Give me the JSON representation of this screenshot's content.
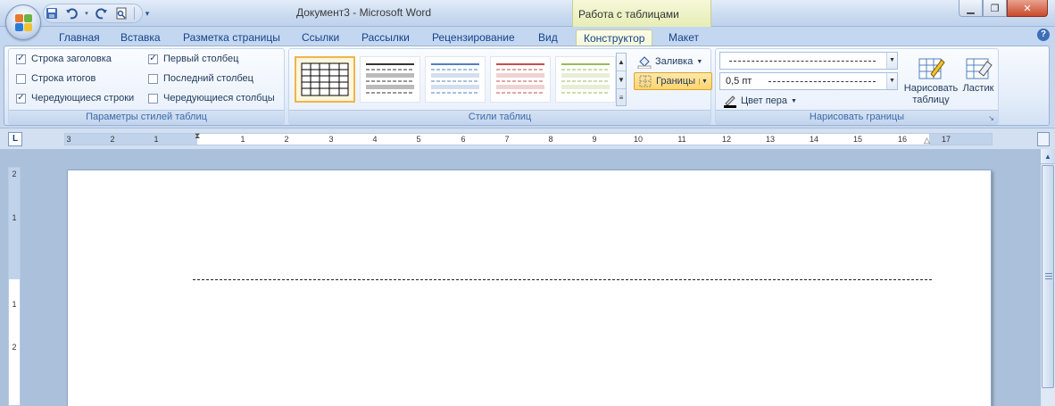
{
  "window": {
    "title": "Документ3 - Microsoft Word",
    "contextual_header": "Работа с таблицами",
    "minimize": "▁",
    "restore": "❐",
    "close": "✕"
  },
  "qat": {
    "icons": [
      "save-icon",
      "undo-icon",
      "redo-icon",
      "print-preview-icon",
      "customize-qat-icon"
    ]
  },
  "tabs": [
    {
      "label": "Главная"
    },
    {
      "label": "Вставка"
    },
    {
      "label": "Разметка страницы"
    },
    {
      "label": "Ссылки"
    },
    {
      "label": "Рассылки"
    },
    {
      "label": "Рецензирование"
    },
    {
      "label": "Вид"
    },
    {
      "label": "Конструктор",
      "active": true
    },
    {
      "label": "Макет"
    }
  ],
  "help": "?",
  "table_style_options": {
    "group_label": "Параметры стилей таблиц",
    "options": [
      {
        "label": "Строка заголовка",
        "checked": true
      },
      {
        "label": "Строка итогов",
        "checked": false
      },
      {
        "label": "Чередующиеся строки",
        "checked": true
      },
      {
        "label": "Первый столбец",
        "checked": true
      },
      {
        "label": "Последний столбец",
        "checked": false
      },
      {
        "label": "Чередующиеся столбцы",
        "checked": false
      }
    ]
  },
  "table_styles": {
    "group_label": "Стили таблиц",
    "shading_label": "Заливка",
    "borders_label": "Границы",
    "thumb_colors": [
      "#333333",
      "#333333",
      "#4f81bd",
      "#c0504d",
      "#9bbb59"
    ]
  },
  "draw_borders": {
    "group_label": "Нарисовать границы",
    "pen_weight": "0,5 пт",
    "pen_color_label": "Цвет пера",
    "draw_table_label_1": "Нарисовать",
    "draw_table_label_2": "таблицу",
    "eraser_label": "Ластик"
  },
  "ruler": {
    "tab_selector": "L",
    "left_labels": [
      "3",
      "2",
      "1"
    ],
    "right_labels": [
      "1",
      "2",
      "3",
      "4",
      "5",
      "6",
      "7",
      "8",
      "9",
      "10",
      "11",
      "12",
      "13",
      "14",
      "15",
      "16",
      "17"
    ],
    "vertical_labels": [
      "2",
      "1",
      "1",
      "2"
    ]
  },
  "colors": {
    "accent": "#15428b",
    "contextual": "#f4f8d8",
    "highlight": "#ffd46e"
  }
}
